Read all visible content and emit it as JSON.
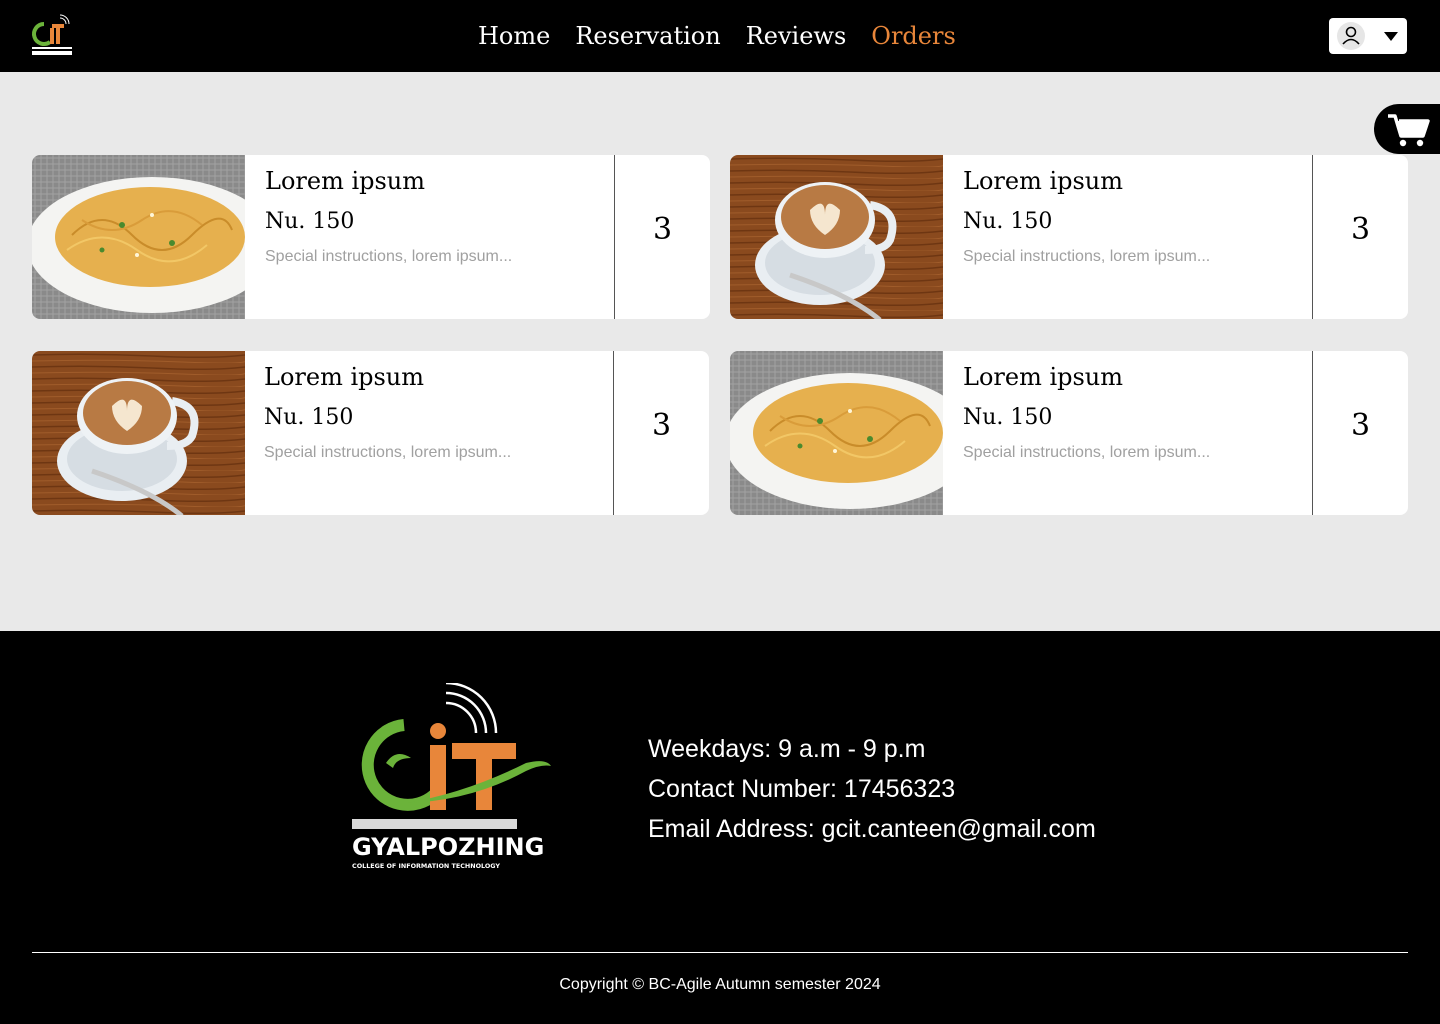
{
  "header": {
    "nav": [
      {
        "label": "Home",
        "active": false
      },
      {
        "label": "Reservation",
        "active": false
      },
      {
        "label": "Reviews",
        "active": false
      },
      {
        "label": "Orders",
        "active": true
      }
    ],
    "accent_color": "#e8863a"
  },
  "orders": [
    {
      "image": "spaghetti-photo",
      "name": "Lorem ipsum",
      "price": "Nu. 150",
      "note": "Special instructions, lorem ipsum...",
      "qty": "3"
    },
    {
      "image": "latte-photo",
      "name": "Lorem ipsum",
      "price": "Nu. 150",
      "note": "Special instructions, lorem ipsum...",
      "qty": "3"
    },
    {
      "image": "latte-photo",
      "name": "Lorem ipsum",
      "price": "Nu. 150",
      "note": "Special instructions, lorem ipsum...",
      "qty": "3"
    },
    {
      "image": "spaghetti-photo",
      "name": "Lorem ipsum",
      "price": "Nu. 150",
      "note": "Special instructions, lorem ipsum...",
      "qty": "3"
    }
  ],
  "footer": {
    "logo_text": "GYALPOZHING",
    "logo_subtext": "COLLEGE OF INFORMATION TECHNOLOGY",
    "hours": "Weekdays: 9 a.m - 9 p.m",
    "contact": "Contact Number: 17456323",
    "email": "Email Address: gcit.canteen@gmail.com",
    "copyright": "Copyright © BC-Agile Autumn semester 2024"
  }
}
